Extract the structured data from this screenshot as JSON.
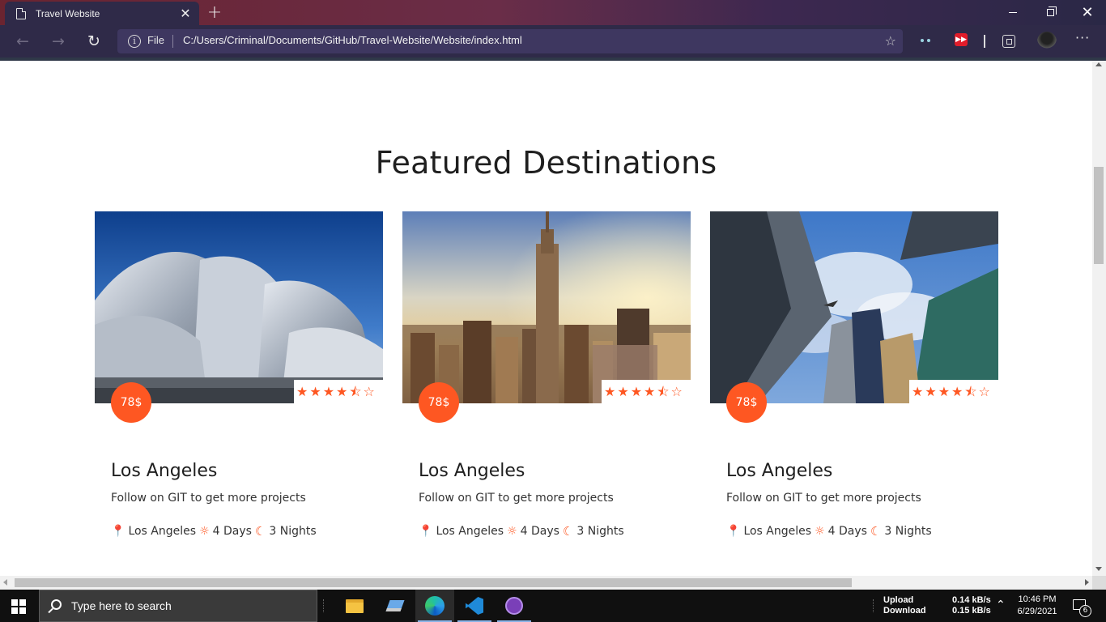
{
  "browser": {
    "tab_title": "Travel Website",
    "address_prefix": "File",
    "url": "C:/Users/Criminal/Documents/GitHub/Travel-Website/Website/index.html",
    "icons": [
      "page-icon",
      "close-icon",
      "plus-icon",
      "back-icon",
      "forward-icon",
      "reload-icon",
      "info-icon",
      "favorite-add-icon",
      "extension-icon",
      "collections-icon",
      "profile-icon",
      "more-icon"
    ]
  },
  "page": {
    "section_title": "Featured Destinations",
    "accent_color": "#fe5722",
    "cards": [
      {
        "price": "78$",
        "rating": 4.5,
        "name": "Los Angeles",
        "description": "Follow on GIT to get more projects",
        "location": "Los Angeles",
        "days": "4 Days",
        "nights": "3 Nights"
      },
      {
        "price": "78$",
        "rating": 4.5,
        "name": "Los Angeles",
        "description": "Follow on GIT to get more projects",
        "location": "Los Angeles",
        "days": "4 Days",
        "nights": "3 Nights"
      },
      {
        "price": "78$",
        "rating": 4.5,
        "name": "Los Angeles",
        "description": "Follow on GIT to get more projects",
        "location": "Los Angeles",
        "days": "4 Days",
        "nights": "3 Nights"
      }
    ]
  },
  "taskbar": {
    "search_placeholder": "Type here to search",
    "net_upload_label": "Upload",
    "net_download_label": "Download",
    "net_upload_value": "0.14 kB/s",
    "net_download_value": "0.15 kB/s",
    "time": "10:46 PM",
    "date": "6/29/2021",
    "notification_count": "6"
  }
}
